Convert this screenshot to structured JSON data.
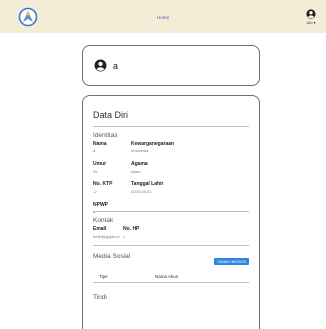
{
  "header": {
    "nav_link": "Home",
    "user_label": "Ulo ▾"
  },
  "profile": {
    "name": "a"
  },
  "data_diri": {
    "title": "Data Diri",
    "identitas": {
      "heading": "Identitas",
      "nama_label": "Nama",
      "nama_value": "a",
      "kewarganegaraan_label": "Kewarganegaraan",
      "kewarganegaraan_value": "Indonesia",
      "umur_label": "Umur",
      "umur_value": "26",
      "agama_label": "Agama",
      "agama_value": "Islam",
      "ktp_label": "No. KTP",
      "ktp_value": "-2",
      "tgl_label": "Tanggal Lahir",
      "tgl_value": "2023-08-01",
      "npwp_label": "NPWP",
      "npwp_value": "a"
    },
    "kontak": {
      "heading": "Kontak",
      "email_label": "Email",
      "email_value": "tuhkf@gojek.id",
      "hp_label": "No. HP",
      "hp_value": "1"
    },
    "media_sosial": {
      "heading": "Media Sosial",
      "add_button": "TAMBAH MEDSOS",
      "col_tipe": "Tipe",
      "col_nama_akun": "Nama Akun"
    },
    "next_section": "Tindi"
  },
  "colors": {
    "topbar_bg": "#f3ecd7",
    "button_bg": "#2e86de",
    "card_border": "#6e6e6e"
  }
}
